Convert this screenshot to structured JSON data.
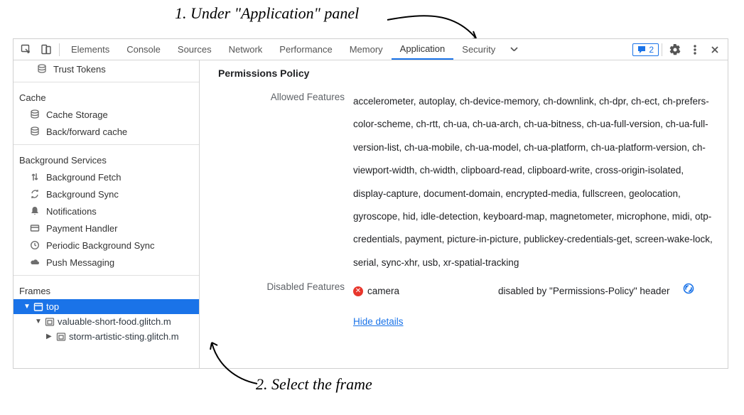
{
  "annotations": {
    "step1": "1. Under \"Application\" panel",
    "step2": "2. Select the frame"
  },
  "tabs": {
    "elements": "Elements",
    "console": "Console",
    "sources": "Sources",
    "network": "Network",
    "performance": "Performance",
    "memory": "Memory",
    "application": "Application",
    "security": "Security"
  },
  "messageCount": "2",
  "sidebar": {
    "trustTokens": "Trust Tokens",
    "cacheTitle": "Cache",
    "cacheStorage": "Cache Storage",
    "backForward": "Back/forward cache",
    "bgTitle": "Background Services",
    "bgFetch": "Background Fetch",
    "bgSync": "Background Sync",
    "notifications": "Notifications",
    "payment": "Payment Handler",
    "periodicSync": "Periodic Background Sync",
    "push": "Push Messaging",
    "framesTitle": "Frames",
    "frame_top": "top",
    "frame_child1": "valuable-short-food.glitch.m",
    "frame_child2": "storm-artistic-sting.glitch.m"
  },
  "content": {
    "heading": "Permissions Policy",
    "allowedLabel": "Allowed Features",
    "allowedFeatures": "accelerometer, autoplay, ch-device-memory, ch-downlink, ch-dpr, ch-ect, ch-prefers-color-scheme, ch-rtt, ch-ua, ch-ua-arch, ch-ua-bitness, ch-ua-full-version, ch-ua-full-version-list, ch-ua-mobile, ch-ua-model, ch-ua-platform, ch-ua-platform-version, ch-viewport-width, ch-width, clipboard-read, clipboard-write, cross-origin-isolated, display-capture, document-domain, encrypted-media, fullscreen, geolocation, gyroscope, hid, idle-detection, keyboard-map, magnetometer, microphone, midi, otp-credentials, payment, picture-in-picture, publickey-credentials-get, screen-wake-lock, serial, sync-xhr, usb, xr-spatial-tracking",
    "disabledLabel": "Disabled Features",
    "disabledFeature": "camera",
    "disabledReason": "disabled by \"Permissions-Policy\" header",
    "hideDetails": "Hide details"
  }
}
